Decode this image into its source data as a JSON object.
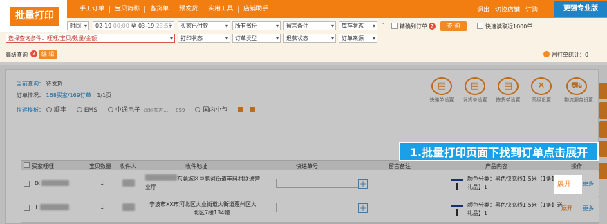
{
  "app": {
    "active_tab": "批量打印",
    "nav_items": [
      "手工订单",
      "宝贝简称",
      "备货单",
      "预发货",
      "实用工具",
      "店铺助手"
    ],
    "top_right": [
      "退出",
      "切换店铺",
      "订购"
    ],
    "pro_badge": "更强专业版"
  },
  "filter": {
    "time_label": "时间",
    "date_from": "02-19",
    "time_from": "00:00",
    "to_label": "至",
    "date_to": "03-19",
    "time_to": "23:59",
    "buyer_paid": "买家已付款",
    "province": "所有省份",
    "remark": "留言备注",
    "stock": "库存状态",
    "precise_label": "精确到订单",
    "search_btn": "查 询",
    "fast_read_label": "快速读取近1000单",
    "condition": "选择查询条件：旺旺/宝贝/数量/金额",
    "print_status": "打印状态",
    "order_type": "订单类型",
    "refund_status": "退款状态",
    "order_source": "订单来源",
    "advanced_label": "高级查询",
    "edit_btn": "编 辑",
    "monthly_stat": "月打单统计：0"
  },
  "summary": {
    "current_query_label": "当前查询：",
    "current_query_value": "待发货",
    "order_info_label": "订单情况：",
    "order_info_value": "168买家/169订单",
    "page_info": "1/1页",
    "template_label": "快递模板：",
    "templates": [
      "顺丰",
      "EMS",
      "中通电子",
      "国内小包"
    ],
    "template_sub": "-深圳布吉…",
    "template_count": "859"
  },
  "tools": [
    {
      "label": "快递单设置",
      "icon": "print-icon"
    },
    {
      "label": "发货单设置",
      "icon": "print-icon"
    },
    {
      "label": "拣货单设置",
      "icon": "print-icon"
    },
    {
      "label": "高级设置",
      "icon": "tools-icon"
    },
    {
      "label": "物流服务设置",
      "icon": "truck-icon"
    }
  ],
  "table": {
    "headers": [
      "买家旺旺",
      "宝贝数量",
      "收件人",
      "收件地址",
      "快递单号",
      "留言备注",
      "产品内容",
      "操作"
    ],
    "rows": [
      {
        "buyer": "tk",
        "qty": "1",
        "address_line1": "东莞城区巨鹏河街道丰料村联通营",
        "address_line2": "业厅",
        "product": "颜色分类：黑色快充线1.5米【1条】送",
        "product2": "礼品】1",
        "expand": "展开",
        "more": "更多"
      },
      {
        "buyer": "T",
        "qty": "1",
        "address_line1": "宁波市XX市河北区大业街道大街道惠州区大",
        "address_line2": "北区7楼134幢",
        "product": "颜色分类：黑色快充线1.5米【1条】送",
        "product2": "礼品】1",
        "expand": "展开",
        "more": "更多"
      }
    ]
  },
  "callout": "1.批量打印页面下找到订单点击展开",
  "highlight_expand": "展开",
  "colors": {
    "brand_orange": "#f27d10",
    "callout_blue": "#1aa0e8"
  }
}
